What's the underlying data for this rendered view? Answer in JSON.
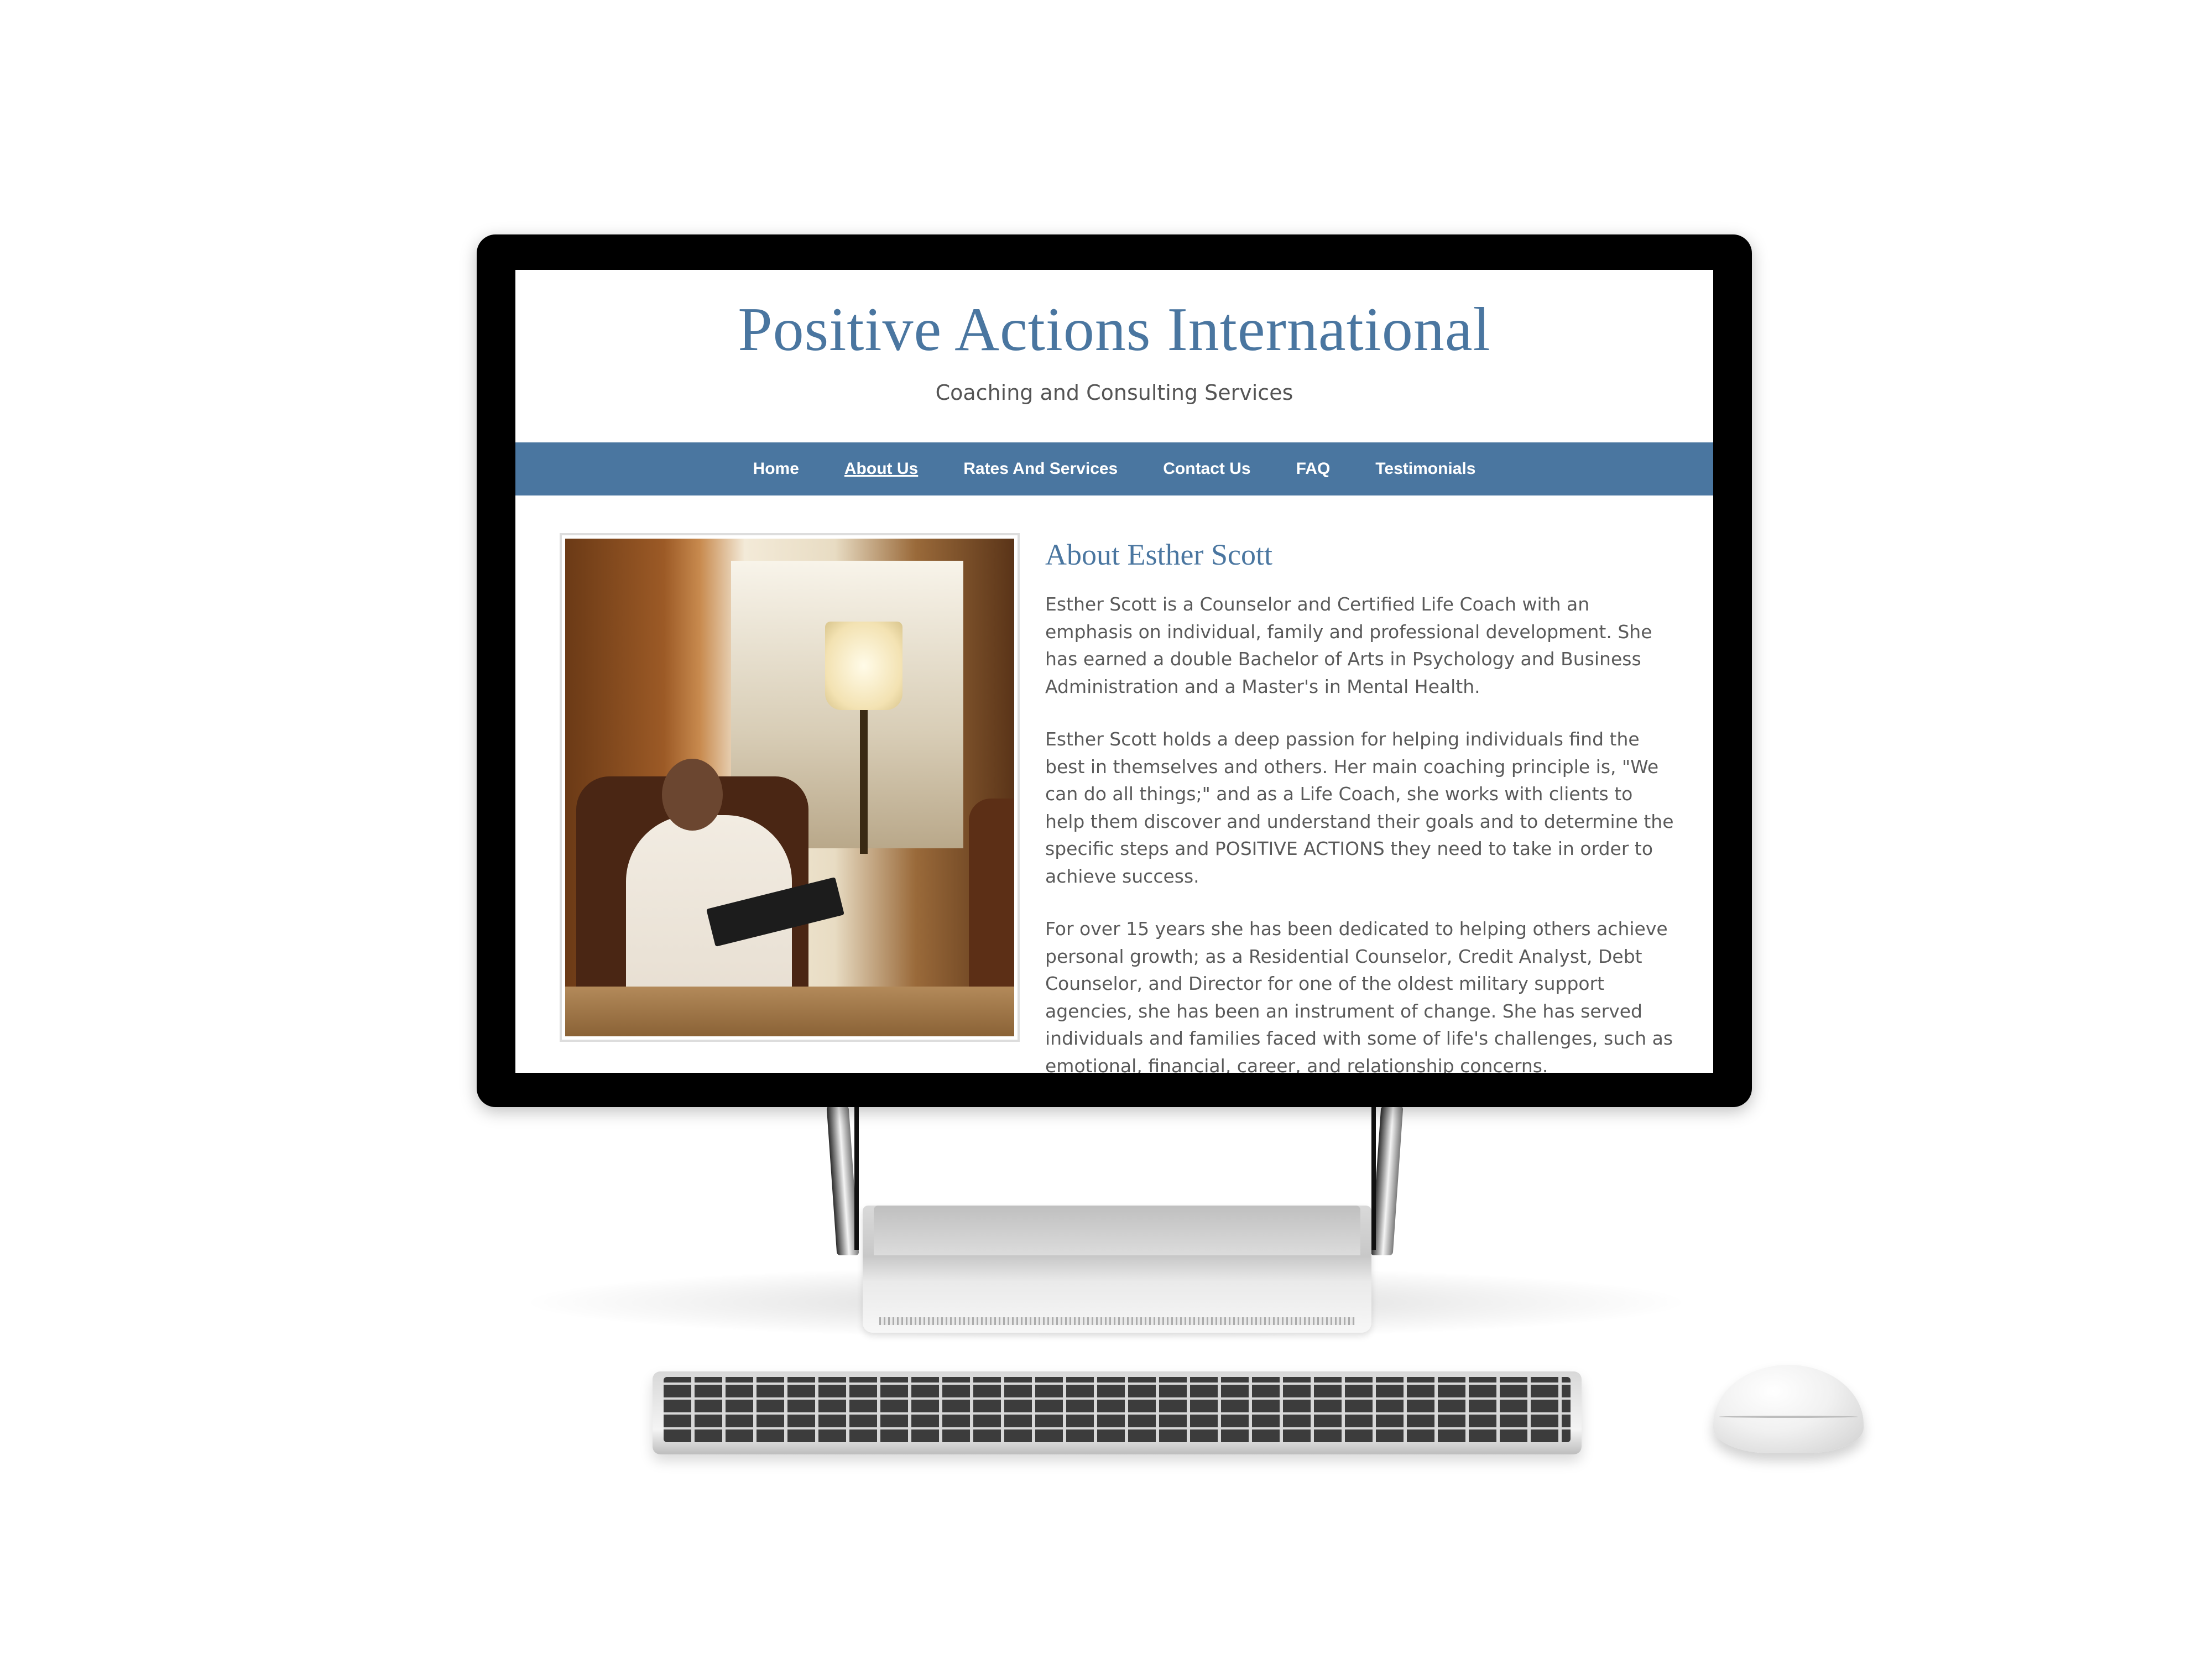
{
  "site": {
    "title": "Positive Actions International",
    "subtitle": "Coaching and Consulting Services"
  },
  "nav": {
    "items": [
      {
        "label": "Home"
      },
      {
        "label": "About Us",
        "active": true
      },
      {
        "label": "Rates And Services"
      },
      {
        "label": "Contact Us"
      },
      {
        "label": "FAQ"
      },
      {
        "label": "Testimonials"
      }
    ]
  },
  "about": {
    "heading": "About Esther Scott",
    "paragraphs": [
      "Esther Scott is a Counselor and Certified Life Coach with an emphasis on individual, family and professional development.  She has earned a double Bachelor of Arts in Psychology and Business Administration and a Master's in Mental Health.",
      "Esther Scott holds a deep passion for helping individuals find the best in themselves and others.   Her main coaching principle is, \"We can do all things;\" and as a Life Coach, she works with clients to help them discover and understand their goals and to determine the specific steps and POSITIVE ACTIONS they need to take in order to achieve success.",
      "For over 15 years she has been dedicated to helping others achieve personal growth; as a Residential Counselor, Credit Analyst, Debt Counselor, and Director for one of the oldest military support agencies, she has been an instrument of change. She has served individuals and families faced with some of life's challenges, such as emotional, financial, career, and relationship concerns."
    ]
  },
  "colors": {
    "brand_blue": "#4a76a0",
    "body_text": "#5a5a5a"
  }
}
